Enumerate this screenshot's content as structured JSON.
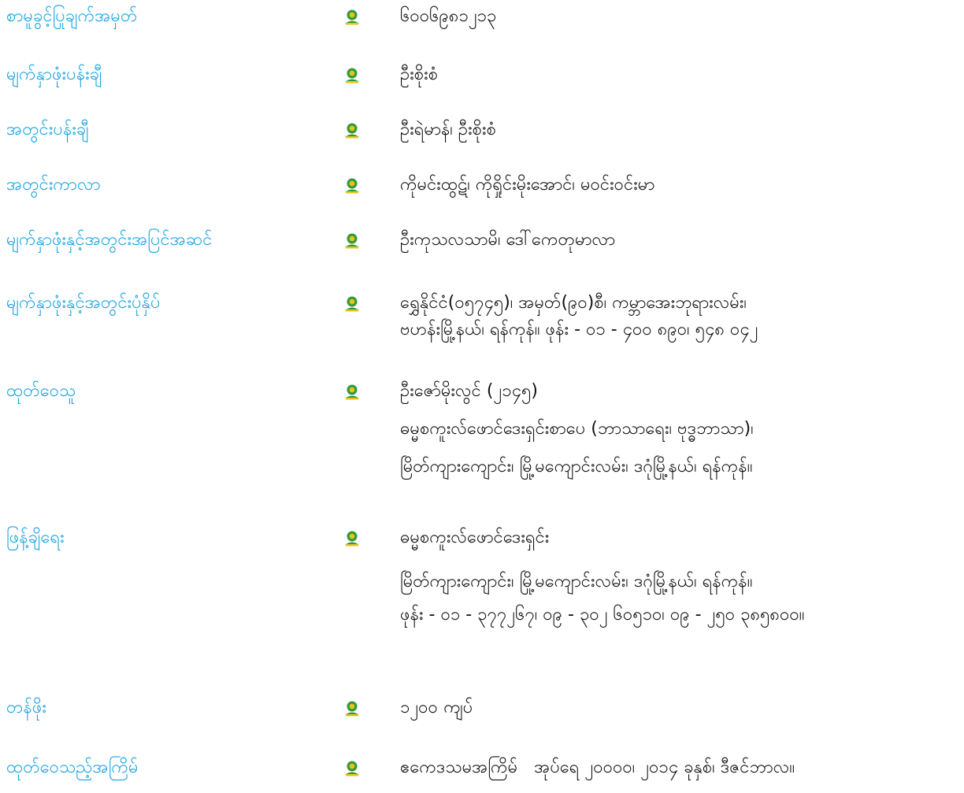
{
  "colors": {
    "label": "#1aa3e0",
    "value": "#111111",
    "icon_green": "#2f9a3a",
    "icon_yellow": "#e8c21c"
  },
  "icon": "dhamma-emblem-icon",
  "rows": [
    {
      "label": "စာမူခွင့်ပြုချက်အမှတ်",
      "lines": [
        "၆၀၀၆၉၈၁၂၁၃"
      ]
    },
    {
      "label": "မျက်နှာဖုံးပန်းချီ",
      "lines": [
        "ဦးစိုးစံ"
      ]
    },
    {
      "label": "အတွင်းပန်းချီ",
      "lines": [
        "ဦးရဲမာန်၊ ဦးစိုးစံ"
      ]
    },
    {
      "label": "အတွင်းကာလာ",
      "lines": [
        "ကိုမင်းထွဋ်၊ ကိုရှိုင်းမိုးအောင်၊ မဝင်းဝင်းမာ"
      ]
    },
    {
      "label": "မျက်နှာဖုံးနှင့်အတွင်းအပြင်အဆင်",
      "lines": [
        "ဦးကုသလသာမိ၊ ဒေါ်ကေတုမာလာ"
      ]
    },
    {
      "label": "မျက်နှာဖုံးနှင့်အတွင်းပုံနှိပ်",
      "lines": [
        "ရွှေနိုင်ငံ(၀၅၇၄၅)၊ အမှတ်(၉၀)စီ၊ ကမ္ဘာအေးဘုရားလမ်း၊",
        "ဗဟန်းမြို့နယ်၊ ရန်ကုန်။ ဖုန်း - ၀၁ - ၄၀၀ ၈၉၀၊ ၅၄၈ ၀၄၂"
      ]
    },
    {
      "label": "ထုတ်ဝေသူ",
      "lines": [
        "ဦးဇော်မိုးလွင် (၂၁၄၅)",
        "ဓမ္မစကူးလ်ဖောင်ဒေးရှင်းစာပေ (ဘာသာရေး၊ ဗုဒ္ဓဘာသာ)၊",
        "မြိတ်ကျားကျောင်း၊ မြို့မကျောင်းလမ်း၊ ဒဂုံမြို့နယ်၊ ရန်ကုန်။"
      ]
    },
    {
      "label": "ဖြန့်ချိရေး",
      "lines": [
        "ဓမ္မစကူးလ်ဖောင်ဒေးရှင်း",
        "မြိတ်ကျားကျောင်း၊ မြို့မကျောင်းလမ်း၊ ဒဂုံမြို့နယ်၊ ရန်ကုန်။",
        "ဖုန်း - ၀၁ - ၃၇၇၂၆၇၊ ၀၉ - ၃၀၂ ၆၀၅၁၀၊ ၀၉ - ၂၅၀ ၃၈၅၈၀၀။"
      ]
    },
    {
      "label": "တန်ဖိုး",
      "lines": [
        "၁၂၀၀ ကျပ်"
      ]
    },
    {
      "label": "ထုတ်ဝေသည့်အကြိမ်",
      "lines": [
        "ဧကေဒသမအကြိမ်   အုပ်ရေ ၂၀၀၀၀၊ ၂၀၁၄ ခုနှစ်၊ ဒီဇင်ဘာလ။"
      ]
    }
  ]
}
